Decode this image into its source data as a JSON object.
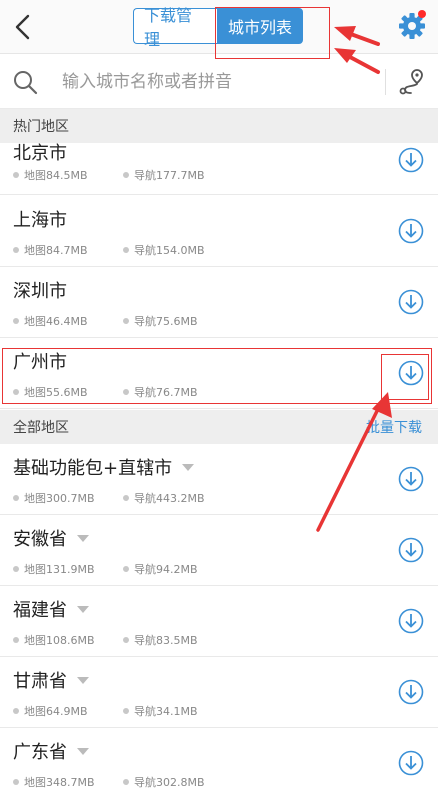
{
  "header": {
    "tabs": [
      {
        "label": "下载管理",
        "active": false
      },
      {
        "label": "城市列表",
        "active": true
      }
    ],
    "back_icon": "chevron-left-icon",
    "settings_icon": "gear-icon",
    "notification_dot_color": "#ff2b2b"
  },
  "search": {
    "placeholder": "输入城市名称或者拼音",
    "left_icon": "search-icon",
    "right_icon": "route-icon"
  },
  "hot": {
    "title": "热门地区",
    "items": [
      {
        "name": "北京市",
        "map": "地图84.5MB",
        "nav": "导航177.7MB",
        "expandable": false
      },
      {
        "name": "上海市",
        "map": "地图84.7MB",
        "nav": "导航154.0MB",
        "expandable": false
      },
      {
        "name": "深圳市",
        "map": "地图46.4MB",
        "nav": "导航75.6MB",
        "expandable": false
      },
      {
        "name": "广州市",
        "map": "地图55.6MB",
        "nav": "导航76.7MB",
        "expandable": false
      }
    ]
  },
  "all": {
    "title": "全部地区",
    "action": "批量下载",
    "items": [
      {
        "name": "基础功能包+直辖市",
        "map": "地图300.7MB",
        "nav": "导航443.2MB",
        "expandable": true
      },
      {
        "name": "安徽省",
        "map": "地图131.9MB",
        "nav": "导航94.2MB",
        "expandable": true
      },
      {
        "name": "福建省",
        "map": "地图108.6MB",
        "nav": "导航83.5MB",
        "expandable": true
      },
      {
        "name": "甘肃省",
        "map": "地图64.9MB",
        "nav": "导航34.1MB",
        "expandable": true
      },
      {
        "name": "广东省",
        "map": "地图348.7MB",
        "nav": "导航302.8MB",
        "expandable": true
      }
    ]
  },
  "colors": {
    "accent": "#3a90d6",
    "annotation": "#e83535",
    "section_bg": "#eeeeee"
  }
}
